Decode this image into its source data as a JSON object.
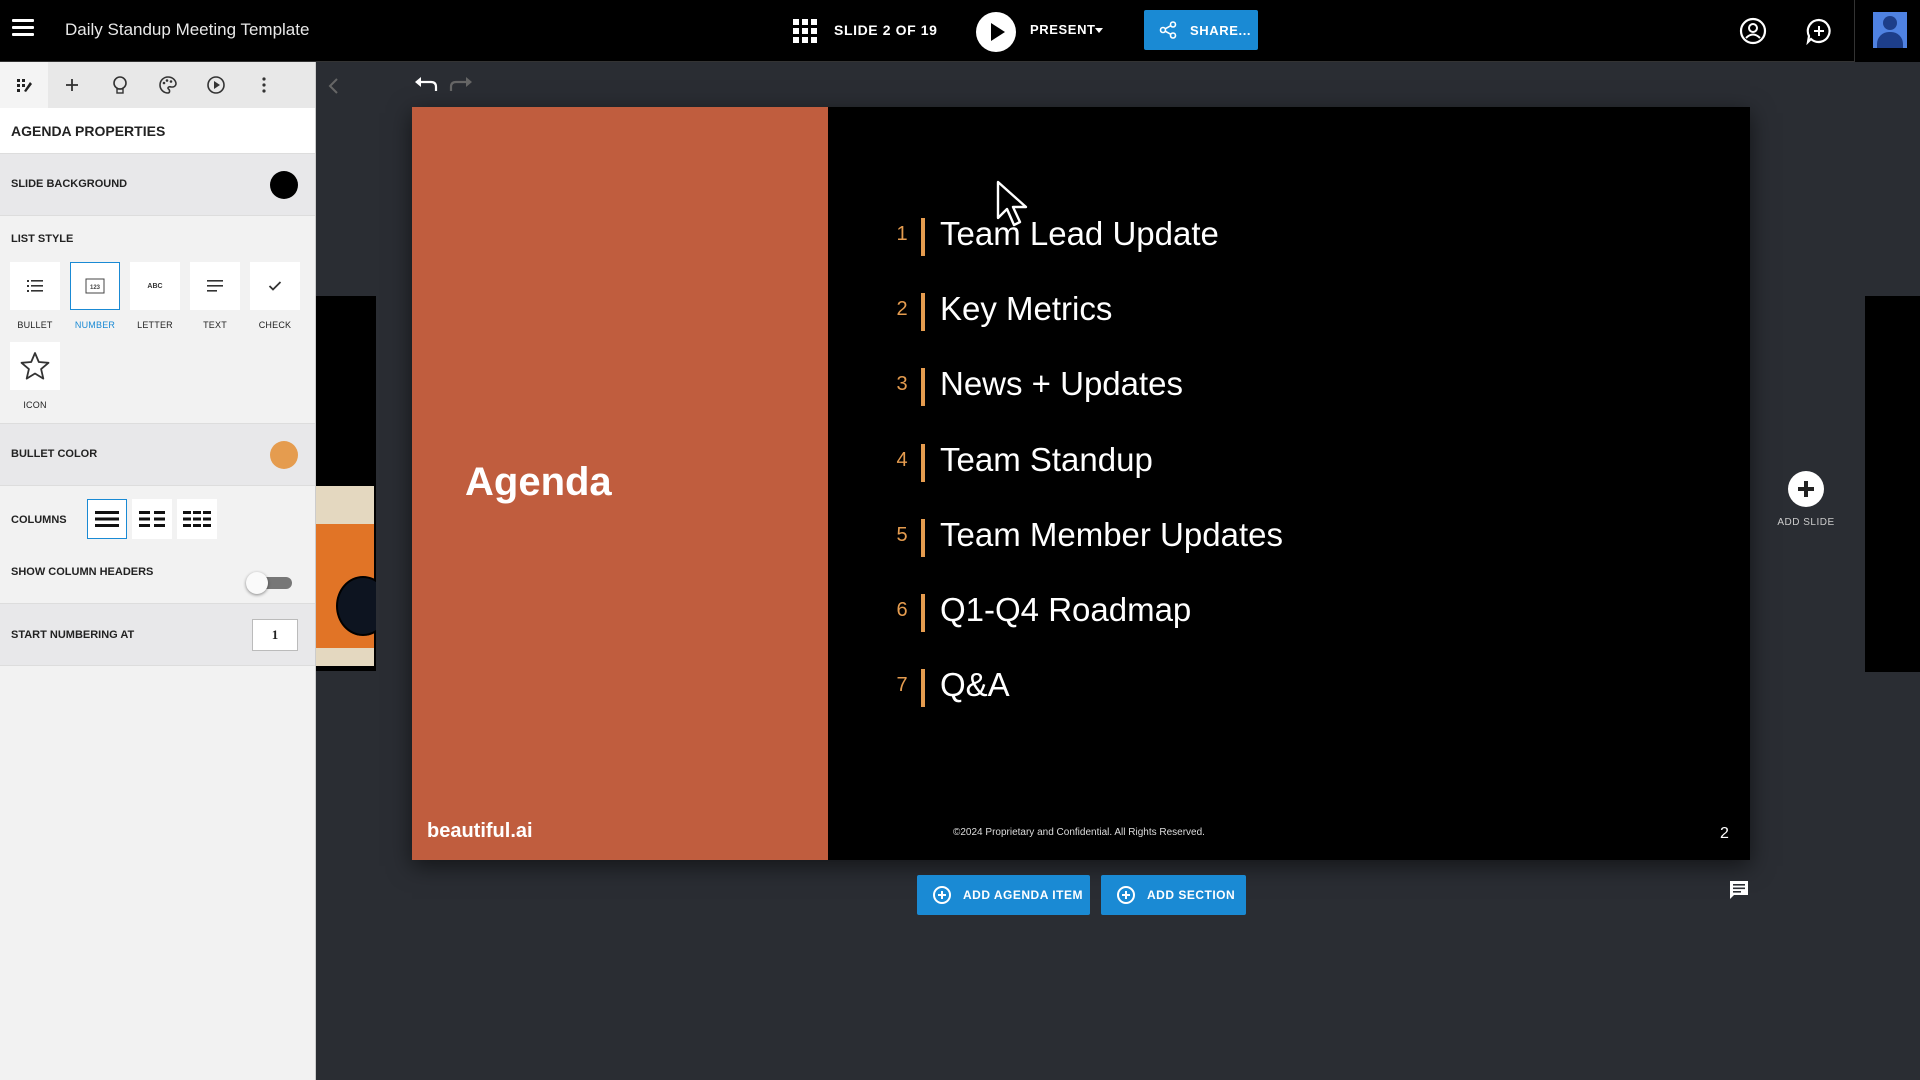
{
  "app": {
    "doc_title": "Daily Standup Meeting Template",
    "slide_counter": "SLIDE 2 OF 19",
    "present_label": "PRESENT",
    "share_label": "SHARE..."
  },
  "panel": {
    "tabs": [
      "layout-icon",
      "plus-icon",
      "lightbulb-icon",
      "palette-icon",
      "play-circle-icon",
      "more-icon"
    ],
    "title": "AGENDA PROPERTIES",
    "slide_background_label": "SLIDE BACKGROUND",
    "slide_background_color": "#000000",
    "list_style_label": "LIST STYLE",
    "list_styles": [
      {
        "label": "BULLET",
        "icon": "bullet-list-icon"
      },
      {
        "label": "NUMBER",
        "icon": "number-list-icon"
      },
      {
        "label": "LETTER",
        "icon": "letter-list-icon"
      },
      {
        "label": "TEXT",
        "icon": "text-list-icon"
      },
      {
        "label": "CHECK",
        "icon": "check-list-icon"
      },
      {
        "label": "ICON",
        "icon": "star-icon"
      }
    ],
    "selected_list_style": "NUMBER",
    "number_icon_text": "123",
    "letter_icon_text": "ABC",
    "bullet_color_label": "BULLET COLOR",
    "bullet_color": "#e59c4f",
    "columns_label": "COLUMNS",
    "columns_selected": 1,
    "show_column_headers_label": "SHOW COLUMN HEADERS",
    "show_column_headers": false,
    "start_numbering_label": "START NUMBERING AT",
    "start_numbering_value": "1"
  },
  "slide": {
    "title": "Agenda",
    "brand": "beautiful.ai",
    "items": [
      {
        "num": "1",
        "text": "Team Lead Update"
      },
      {
        "num": "2",
        "text": "Key Metrics"
      },
      {
        "num": "3",
        "text": "News + Updates"
      },
      {
        "num": "4",
        "text": "Team Standup"
      },
      {
        "num": "5",
        "text": "Team Member Updates"
      },
      {
        "num": "6",
        "text": "Q1-Q4 Roadmap"
      },
      {
        "num": "7",
        "text": "Q&A"
      }
    ],
    "copyright": "©2024 Proprietary and Confidential. All Rights Reserved.",
    "page_number": "2",
    "left_panel_color": "#c05d3e",
    "accent_color": "#e59c4f"
  },
  "canvas": {
    "add_slide_label": "ADD SLIDE",
    "add_agenda_item_label": "ADD AGENDA ITEM",
    "add_section_label": "ADD SECTION"
  }
}
